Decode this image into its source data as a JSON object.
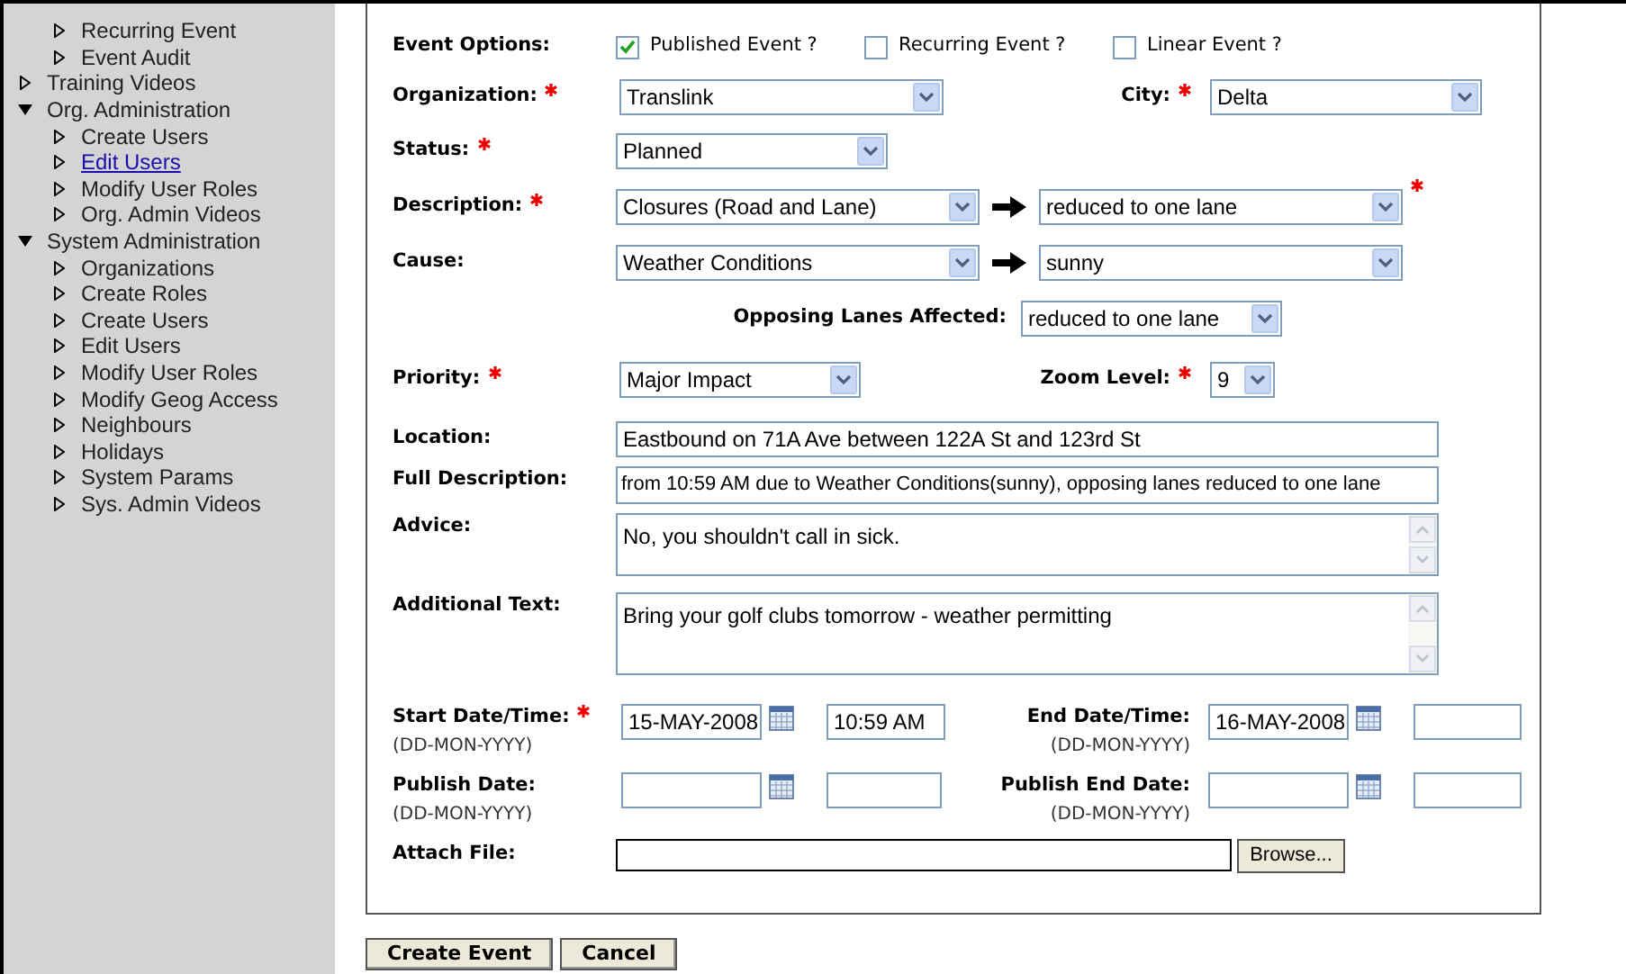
{
  "sidebar": {
    "items": [
      {
        "children": [
          {
            "label": "Recurring Event",
            "expanded": false,
            "selected": false
          },
          {
            "label": "Event Audit",
            "expanded": false,
            "selected": false
          }
        ]
      },
      {
        "label": "Training Videos",
        "expanded": false
      },
      {
        "label": "Org. Administration",
        "expanded": true,
        "children": [
          {
            "label": "Create Users",
            "expanded": false,
            "selected": false
          },
          {
            "label": "Edit Users",
            "expanded": false,
            "selected": true
          },
          {
            "label": "Modify User Roles",
            "expanded": false,
            "selected": false
          },
          {
            "label": "Org. Admin Videos",
            "expanded": false,
            "selected": false
          }
        ]
      },
      {
        "label": "System Administration",
        "expanded": true,
        "children": [
          {
            "label": "Organizations",
            "expanded": false,
            "selected": false
          },
          {
            "label": "Create Roles",
            "expanded": false,
            "selected": false
          },
          {
            "label": "Create Users",
            "expanded": false,
            "selected": false
          },
          {
            "label": "Edit Users",
            "expanded": false,
            "selected": false
          },
          {
            "label": "Modify User Roles",
            "expanded": false,
            "selected": false
          },
          {
            "label": "Modify Geog Access",
            "expanded": false,
            "selected": false
          },
          {
            "label": "Neighbours",
            "expanded": false,
            "selected": false
          },
          {
            "label": "Holidays",
            "expanded": false,
            "selected": false
          },
          {
            "label": "System Params",
            "expanded": false,
            "selected": false
          },
          {
            "label": "Sys. Admin Videos",
            "expanded": false,
            "selected": false
          }
        ]
      }
    ]
  },
  "form": {
    "event_options": {
      "label": "Event Options:",
      "options": [
        {
          "label": "Published Event ?",
          "checked": true
        },
        {
          "label": "Recurring Event ?",
          "checked": false
        },
        {
          "label": "Linear Event ?",
          "checked": false
        }
      ]
    },
    "organization": {
      "label": "Organization:",
      "required": true,
      "value": "Translink"
    },
    "city": {
      "label": "City:",
      "required": true,
      "value": "Delta"
    },
    "status": {
      "label": "Status:",
      "required": true,
      "value": "Planned"
    },
    "description": {
      "label": "Description:",
      "required": true,
      "value": "Closures (Road and Lane)",
      "detail_value": "reduced to one lane",
      "detail_required": true
    },
    "cause": {
      "label": "Cause:",
      "value": "Weather Conditions",
      "detail_value": "sunny"
    },
    "opposing_lanes": {
      "label": "Opposing Lanes Affected:",
      "value": "reduced to one lane"
    },
    "priority": {
      "label": "Priority:",
      "required": true,
      "value": "Major Impact"
    },
    "zoom_level": {
      "label": "Zoom Level:",
      "required": true,
      "value": "9"
    },
    "location": {
      "label": "Location:",
      "value": "Eastbound on 71A Ave between 122A St and 123rd St"
    },
    "full_description": {
      "label": "Full Description:",
      "value": "from 10:59 AM due to Weather Conditions(sunny), opposing lanes reduced to one lane"
    },
    "advice": {
      "label": "Advice:",
      "value": "No, you shouldn't call in sick."
    },
    "additional_text": {
      "label": "Additional Text:",
      "value": "Bring your golf clubs tomorrow - weather permitting"
    },
    "start": {
      "label": "Start Date/Time:",
      "required": true,
      "hint": "(DD-MON-YYYY)",
      "date": "15-MAY-2008",
      "time": "10:59 AM"
    },
    "end": {
      "label": "End Date/Time:",
      "hint": "(DD-MON-YYYY)",
      "date": "16-MAY-2008"
    },
    "publish": {
      "label": "Publish Date:",
      "hint": "(DD-MON-YYYY)"
    },
    "publish_end": {
      "label": "Publish End Date:",
      "hint": "(DD-MON-YYYY)"
    },
    "attach_file": {
      "label": "Attach File:",
      "button": "Browse..."
    }
  },
  "actions": [
    "Create Event",
    "Cancel"
  ]
}
